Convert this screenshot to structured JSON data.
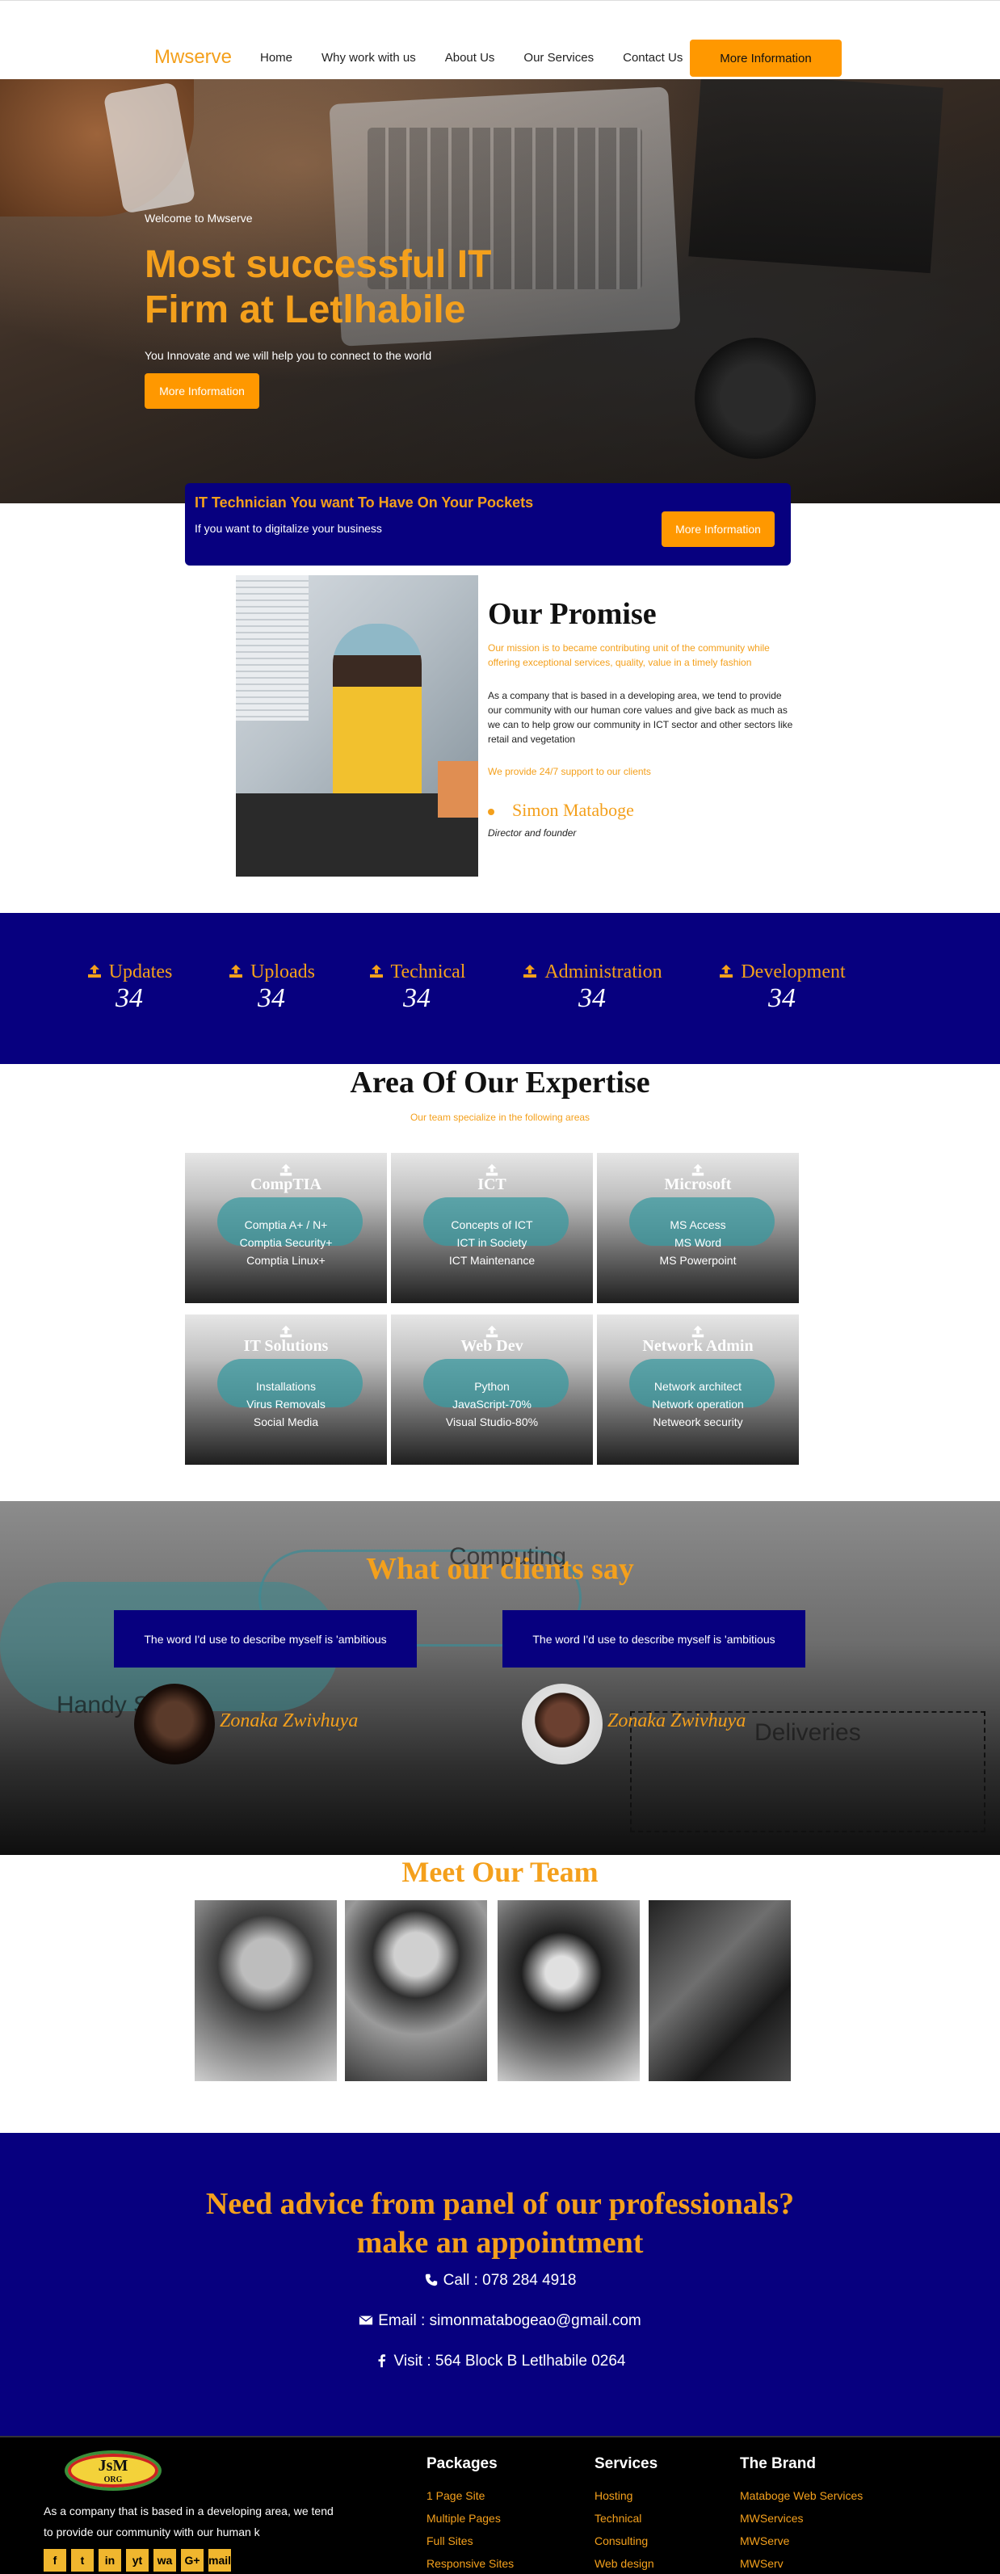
{
  "nav": {
    "brand": "Mwserve",
    "links": [
      "Home",
      "Why work with us",
      "About Us",
      "Our Services",
      "Contact Us"
    ],
    "cta": "More Information"
  },
  "hero": {
    "welcome": "Welcome to Mwserve",
    "title": "Most successful IT Firm at Letlhabile",
    "tagline": "You Innovate and we will help you to connect to the world",
    "button": "More Information"
  },
  "banner": {
    "title": "IT Technician You want To Have On Your Pockets",
    "text": "If you want to digitalize your business",
    "button": "More Information"
  },
  "promise": {
    "title": "Our Promise",
    "lead": "Our mission is to became contributing unit of the community while offering exceptional services, quality, value in a timely fashion",
    "body": "As a company that is based in a developing area, we tend to provide our community with our human core values and give back as much as we can to help grow our community in ICT sector and other sectors like retail and vegetation",
    "support": "We provide 24/7 support to our clients",
    "founder_name": "Simon Mataboge",
    "founder_role": "Director and founder"
  },
  "stats": [
    {
      "label": "Updates",
      "value": "34",
      "icon": "upload-icon"
    },
    {
      "label": "Uploads",
      "value": "34",
      "icon": "upload-icon"
    },
    {
      "label": "Technical",
      "value": "34",
      "icon": "upload-icon"
    },
    {
      "label": "Administration",
      "value": "34",
      "icon": "upload-icon"
    },
    {
      "label": "Development",
      "value": "34",
      "icon": "upload-icon"
    }
  ],
  "expertise": {
    "title": "Area Of Our Expertise",
    "subtitle": "Our team specialize in the following areas",
    "cards": [
      {
        "title": "CompTIA",
        "items": [
          "Comptia A+ / N+",
          "Comptia Security+",
          "Comptia Linux+"
        ]
      },
      {
        "title": "ICT",
        "items": [
          "Concepts of ICT",
          "ICT in Society",
          "ICT Maintenance"
        ]
      },
      {
        "title": "Microsoft",
        "items": [
          "MS Access",
          "MS Word",
          "MS Powerpoint"
        ]
      },
      {
        "title": "IT Solutions",
        "items": [
          "Installations",
          "Virus Removals",
          "Social Media"
        ]
      },
      {
        "title": "Web Dev",
        "items": [
          "Python",
          "JavaScript-70%",
          "Visual Studio-80%"
        ]
      },
      {
        "title": "Network Admin",
        "items": [
          "Network architect",
          "Network operation",
          "Netweork security"
        ]
      }
    ]
  },
  "testimonials": {
    "title": "What our clients say",
    "items": [
      {
        "quote": "The word I'd use to describe myself is 'ambitious",
        "name": "Zonaka Zwivhuya"
      },
      {
        "quote": "The word I'd use to describe myself is 'ambitious",
        "name": "Zonaka Zwivhuya"
      }
    ],
    "background_words": [
      "Computing",
      "Handy S",
      "Deliveries"
    ]
  },
  "team": {
    "title": "Meet Our Team"
  },
  "appointment": {
    "title_line1": "Need advice from panel of our professionals?",
    "title_line2": "make an appointment",
    "call": "Call : 078 284 4918",
    "email": "Email : simonmatabogeao@gmail.com",
    "visit": "Visit : 564 Block B Letlhabile 0264"
  },
  "footer": {
    "logo_text": "JsM",
    "logo_sub": "ORG",
    "description": "As a company that is based in a developing area, we tend to provide our community with our human k",
    "socials": [
      "f",
      "t",
      "in",
      "yt",
      "wa",
      "G+",
      "mail"
    ],
    "columns": [
      {
        "heading": "Packages",
        "items": [
          "1 Page Site",
          "Multiple Pages",
          "Full Sites",
          "Responsive Sites"
        ]
      },
      {
        "heading": "Services",
        "items": [
          "Hosting",
          "Technical",
          "Consulting",
          "Web design"
        ]
      },
      {
        "heading": "The Brand",
        "items": [
          "Mataboge Web Services",
          "MWServices",
          "MWServe",
          "MWServ"
        ]
      }
    ]
  },
  "colors": {
    "accent": "#f4a01c",
    "button": "#ff9800",
    "navy": "#07007f"
  }
}
